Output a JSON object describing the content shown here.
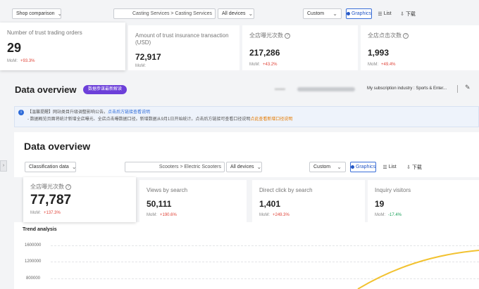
{
  "top": {
    "shop_select": "Shop comparison",
    "category_path": "Casting Services > Casting Services",
    "devices_select": "All devices",
    "period_select": "Custom",
    "graphics_label": "Graphics",
    "list_label": "List",
    "download_label": "下载",
    "metrics": [
      {
        "label": "Number of trust trading orders",
        "value": "29",
        "mom_label": "MoM:",
        "mom_value": "+93.3%"
      },
      {
        "label": "Amount of trust insurance transaction (USD)",
        "value": "72,917",
        "mom_label": "MoM:",
        "mom_value": ""
      },
      {
        "label": "全店曝光次数",
        "value": "217,286",
        "mom_label": "MoM:",
        "mom_value": "+43.2%"
      },
      {
        "label": "全店点击次数",
        "value": "1,993",
        "mom_label": "MoM:",
        "mom_value": "+49.4%"
      }
    ]
  },
  "overview1": {
    "title": "Data overview",
    "badge": "数据参谋最新解读",
    "masked_account": "▪▪▪▪▪▪",
    "subscription": "My subscription industry : Sports & Enter..."
  },
  "notice": {
    "line1_prefix": "【温馨提醒】网站类目升级调整影响公告。",
    "line1_mid": "点击后方链接查看说明",
    "line1_link": "点击后方链接查看说明",
    "line2_prefix": "- 数据概览页面将统计新增全店曝光、全店点击曝数据口径。新增数据从9月1日开始统计。",
    "line2_mid": "点击后方链接可查看口径说明",
    "line2_link": "点此查看新增口径说明"
  },
  "overview2": {
    "title": "Data overview",
    "classification_select": "Classification data",
    "category_path": "Scooters > Electric Scooters",
    "devices_select": "All devices",
    "period_select": "Custom",
    "graphics_label": "Graphics",
    "list_label": "List",
    "download_label": "下载",
    "metrics": [
      {
        "label": "全店曝光次数",
        "value": "77,787",
        "mom_label": "MoM:",
        "mom_value": "+137.3%",
        "trend": "up"
      },
      {
        "label": "Views by search",
        "value": "50,111",
        "mom_label": "MoM:",
        "mom_value": "+190.6%",
        "trend": "up"
      },
      {
        "label": "Direct click by search",
        "value": "1,401",
        "mom_label": "MoM:",
        "mom_value": "+249.3%",
        "trend": "up"
      },
      {
        "label": "Inquiry visitors",
        "value": "19",
        "mom_label": "MoM:",
        "mom_value": "-17.4%",
        "trend": "down"
      }
    ]
  },
  "trend": {
    "title": "Trend analysis",
    "y_ticks": [
      "1600000",
      "1200000",
      "800000"
    ]
  },
  "colors": {
    "accent": "#2457c5",
    "badge_purple": "#6c3fd9",
    "up_red": "#e0453a",
    "down_green": "#18a058",
    "curve": "#f2c230"
  }
}
